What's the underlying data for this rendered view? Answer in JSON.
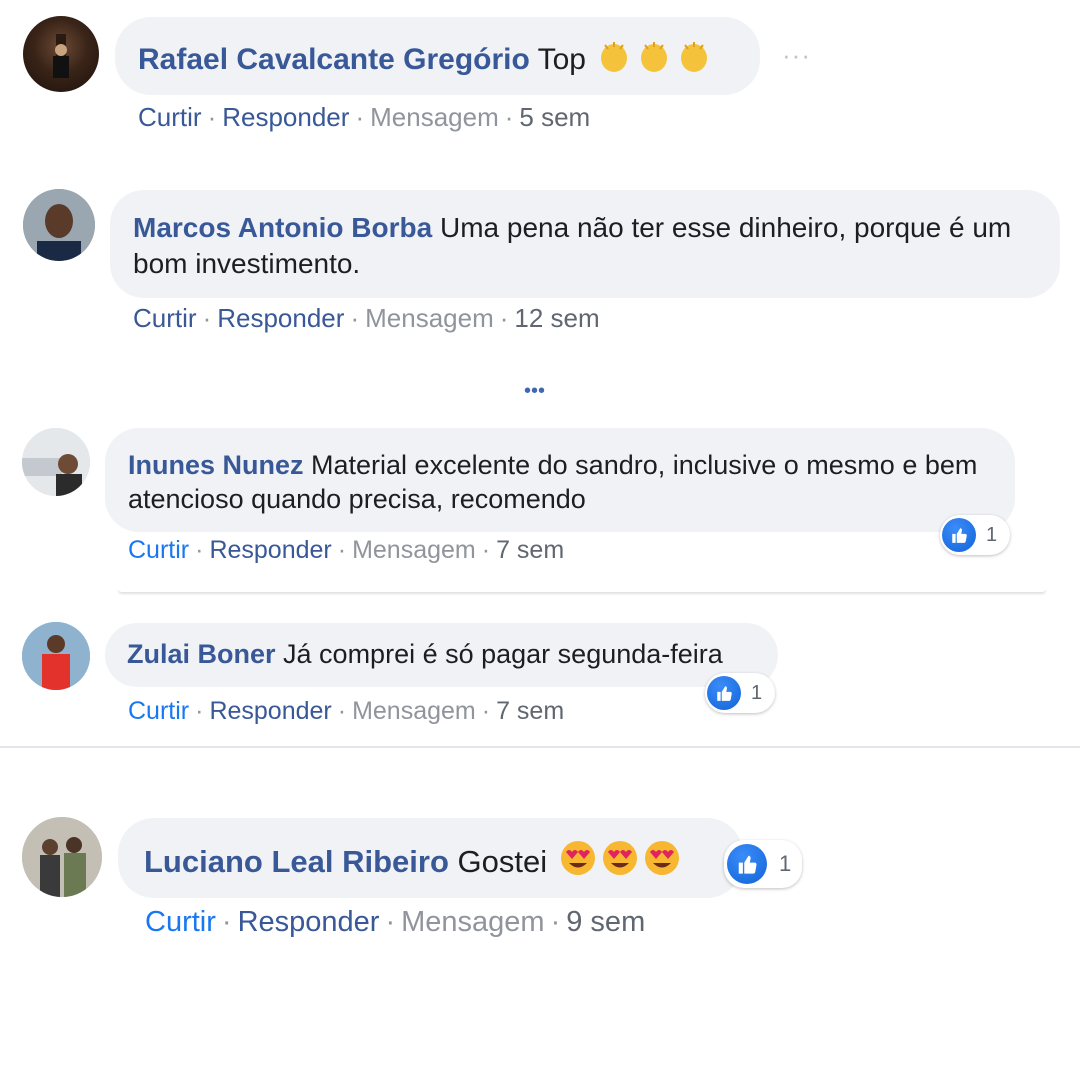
{
  "comments": [
    {
      "author": "Rafael Cavalcante Gregório",
      "text": "Top",
      "emoji": "clapping-hands",
      "actions": {
        "like": "Curtir",
        "reply": "Responder",
        "message": "Mensagem",
        "time": "5 sem"
      }
    },
    {
      "author": "Marcos Antonio Borba",
      "text": "Uma pena não ter esse dinheiro, porque é um bom investimento.",
      "actions": {
        "like": "Curtir",
        "reply": "Responder",
        "message": "Mensagem",
        "time": "12 sem"
      }
    },
    {
      "author": "Inunes Nunez",
      "text": "Material excelente do sandro, inclusive o mesmo e bem atencioso quando precisa, recomendo",
      "reactions": {
        "type": "like",
        "count": "1"
      },
      "actions": {
        "like": "Curtir",
        "reply": "Responder",
        "message": "Mensagem",
        "time": "7 sem"
      }
    },
    {
      "author": "Zulai Boner",
      "text": "Já comprei é só pagar segunda-feira",
      "reactions": {
        "type": "like",
        "count": "1"
      },
      "actions": {
        "like": "Curtir",
        "reply": "Responder",
        "message": "Mensagem",
        "time": "7 sem"
      }
    },
    {
      "author": "Luciano Leal Ribeiro",
      "text": "Gostei",
      "emoji": "heart-eyes",
      "reactions": {
        "type": "like",
        "count": "1"
      },
      "actions": {
        "like": "Curtir",
        "reply": "Responder",
        "message": "Mensagem",
        "time": "9 sem"
      }
    }
  ],
  "more_comments_indicator": "•••",
  "options_indicator": "···",
  "colors": {
    "name": "#385898",
    "bubble": "#f0f2f5",
    "like_blue": "#1877f2",
    "muted": "#90949c"
  }
}
